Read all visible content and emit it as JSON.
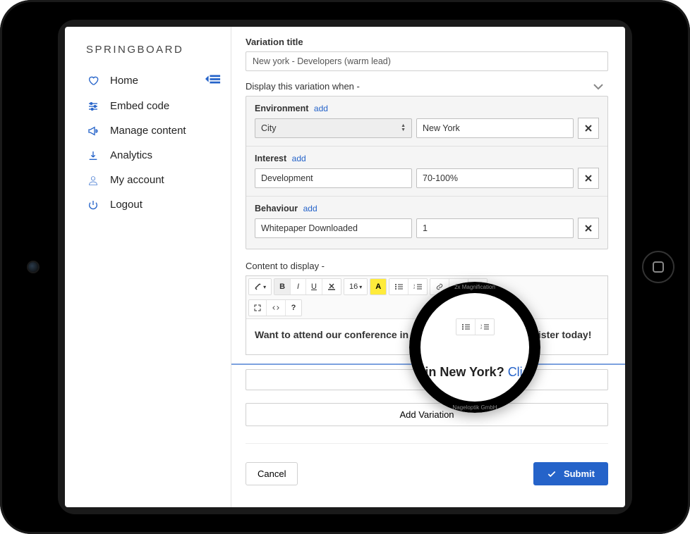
{
  "brand": "SPRINGBOARD",
  "sidebar": {
    "items": [
      {
        "label": "Home"
      },
      {
        "label": "Embed code"
      },
      {
        "label": "Manage content"
      },
      {
        "label": "Analytics"
      },
      {
        "label": "My account"
      },
      {
        "label": "Logout"
      }
    ]
  },
  "variation": {
    "title_label": "Variation title",
    "title_value": "New york - Developers (warm lead)",
    "display_when_label": "Display this variation when -",
    "rules": {
      "environment": {
        "label": "Environment",
        "add": "add",
        "field1": "City",
        "field2": "New York"
      },
      "interest": {
        "label": "Interest",
        "add": "add",
        "field1": "Development",
        "field2": "70-100%"
      },
      "behaviour": {
        "label": "Behaviour",
        "add": "add",
        "field1": "Whitepaper Downloaded",
        "field2": "1"
      }
    },
    "content_label": "Content to display -",
    "editor_toolbar": {
      "fontsize": "16"
    },
    "content_text_before": "Want to attend our conference in New York?",
    "content_link": "Click here",
    "content_text_after": " to register today!"
  },
  "add_variation_label": "Add Variation",
  "footer": {
    "cancel": "Cancel",
    "submit": "Submit"
  },
  "magnifier": {
    "top_text": "2x Magnification",
    "bottom_text": "Nageloptik GmbH",
    "text_frag_before": "e in New York? ",
    "text_link": "Click",
    "text_frag_after": "er today!"
  }
}
